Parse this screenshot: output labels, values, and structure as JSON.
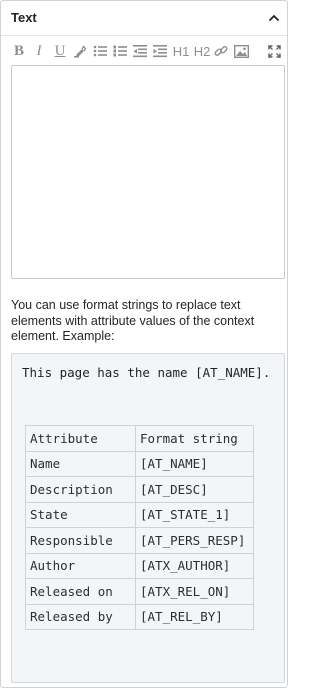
{
  "panel": {
    "title": "Text",
    "collapse_icon": "chevron-up-icon"
  },
  "toolbar": {
    "bold": "B",
    "italic": "I",
    "underline": "U",
    "highlight_icon": "highlighter-icon",
    "bullet_list_icon": "bullet-list-icon",
    "numbered_list_icon": "numbered-list-icon",
    "outdent_icon": "outdent-icon",
    "indent_icon": "indent-icon",
    "h1": "H1",
    "h2": "H2",
    "link_icon": "link-icon",
    "image_icon": "image-icon",
    "fullscreen_icon": "fullscreen-icon"
  },
  "editor": {
    "value": ""
  },
  "help": {
    "text": "You can use format strings to replace text elements with attribute values of the context element. Example:"
  },
  "example": {
    "line": "This page has the name [AT_NAME].",
    "table": {
      "headers": [
        "Attribute",
        "Format string"
      ],
      "rows": [
        [
          "Name",
          "[AT_NAME]"
        ],
        [
          "Description",
          "[AT_DESC]"
        ],
        [
          "State",
          "[AT_STATE_1]"
        ],
        [
          "Responsible",
          "[AT_PERS_RESP]"
        ],
        [
          "Author",
          "[ATX_AUTHOR]"
        ],
        [
          "Released on",
          "[ATX_REL_ON]"
        ],
        [
          "Released by",
          "[AT_REL_BY]"
        ]
      ]
    }
  }
}
